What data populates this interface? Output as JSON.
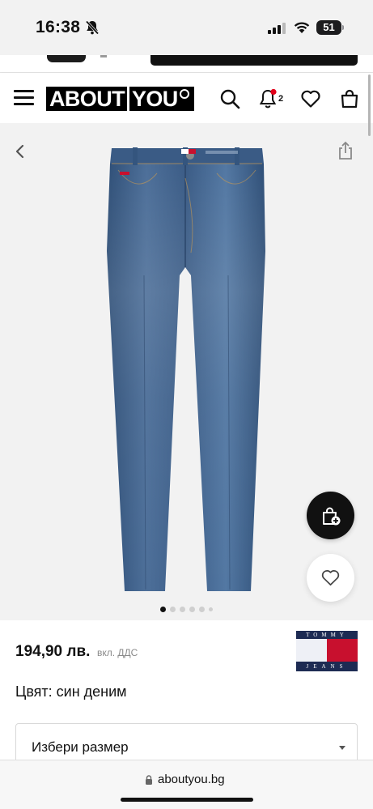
{
  "status_bar": {
    "time": "16:38",
    "battery": "51"
  },
  "header": {
    "logo_left": "ABOUT",
    "logo_right": "YOU",
    "notification_count": "2",
    "accent_color": "#e2001a"
  },
  "gallery": {
    "image_alt": "Tommy Jeans blue skinny jeans",
    "image_count": 6,
    "active_index": 0
  },
  "product": {
    "price": "194,90 лв.",
    "vat_note": "вкл. ДДС",
    "color_line": "Цвят: син деним",
    "brand_line1": "TOMMY",
    "brand_line2": "JEANS",
    "size_placeholder": "Избери размер"
  },
  "browser": {
    "url": "aboutyou.bg"
  }
}
